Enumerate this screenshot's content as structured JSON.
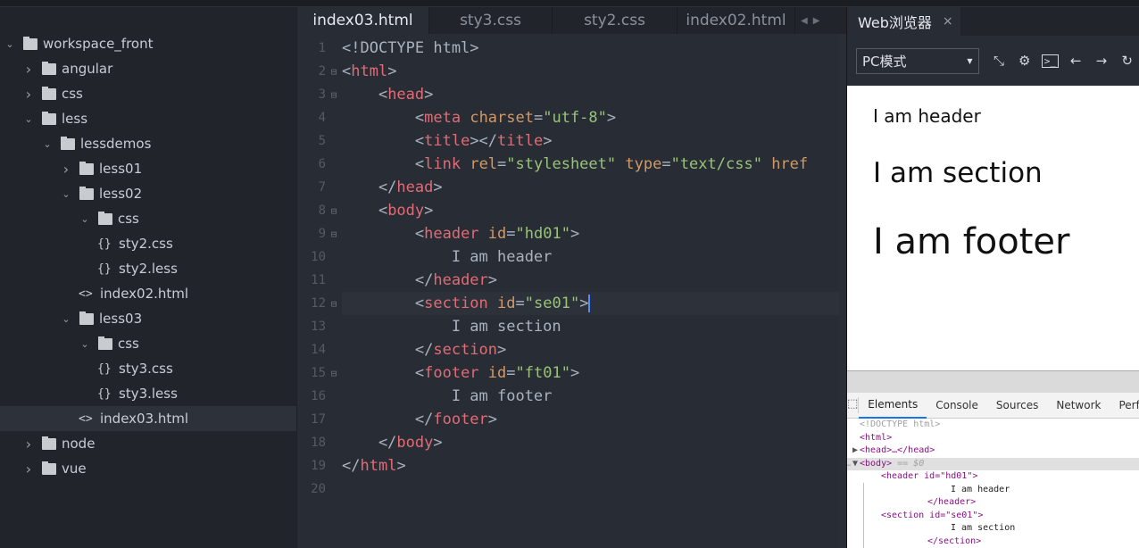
{
  "sidebar": {
    "items": [
      {
        "label": "workspace_front",
        "depth": 0,
        "kind": "project",
        "expanded": true
      },
      {
        "label": "angular",
        "depth": 1,
        "kind": "folder",
        "expanded": false
      },
      {
        "label": "css",
        "depth": 1,
        "kind": "folder",
        "expanded": false
      },
      {
        "label": "less",
        "depth": 1,
        "kind": "folder",
        "expanded": true
      },
      {
        "label": "lessdemos",
        "depth": 2,
        "kind": "folder",
        "expanded": true
      },
      {
        "label": "less01",
        "depth": 3,
        "kind": "folder",
        "expanded": false
      },
      {
        "label": "less02",
        "depth": 3,
        "kind": "folder",
        "expanded": true
      },
      {
        "label": "css",
        "depth": 4,
        "kind": "folder",
        "expanded": true
      },
      {
        "label": "sty2.css",
        "depth": 5,
        "kind": "css"
      },
      {
        "label": "sty2.less",
        "depth": 5,
        "kind": "css"
      },
      {
        "label": "index02.html",
        "depth": 4,
        "kind": "html"
      },
      {
        "label": "less03",
        "depth": 3,
        "kind": "folder",
        "expanded": true
      },
      {
        "label": "css",
        "depth": 4,
        "kind": "folder",
        "expanded": true
      },
      {
        "label": "sty3.css",
        "depth": 5,
        "kind": "css"
      },
      {
        "label": "sty3.less",
        "depth": 5,
        "kind": "css"
      },
      {
        "label": "index03.html",
        "depth": 4,
        "kind": "html",
        "selected": true
      },
      {
        "label": "node",
        "depth": 1,
        "kind": "folder",
        "expanded": false
      },
      {
        "label": "vue",
        "depth": 1,
        "kind": "folder",
        "expanded": false
      }
    ]
  },
  "editor": {
    "tabs": [
      {
        "label": "index03.html",
        "active": true
      },
      {
        "label": "sty3.css"
      },
      {
        "label": "sty2.css"
      },
      {
        "label": "index02.html"
      }
    ],
    "current_line": 12,
    "lines": [
      [
        [
          "p",
          "<!DOCTYPE html>"
        ]
      ],
      [
        [
          "p",
          "<"
        ],
        [
          "t",
          "html"
        ],
        [
          "p",
          ">"
        ]
      ],
      [
        [
          "p",
          "    <"
        ],
        [
          "t",
          "head"
        ],
        [
          "p",
          ">"
        ]
      ],
      [
        [
          "p",
          "        <"
        ],
        [
          "t",
          "meta"
        ],
        [
          "p",
          " "
        ],
        [
          "a",
          "charset"
        ],
        [
          "p",
          "="
        ],
        [
          "s",
          "\"utf-8\""
        ],
        [
          "p",
          ">"
        ]
      ],
      [
        [
          "p",
          "        <"
        ],
        [
          "t",
          "title"
        ],
        [
          "p",
          "></"
        ],
        [
          "t",
          "title"
        ],
        [
          "p",
          ">"
        ]
      ],
      [
        [
          "p",
          "        <"
        ],
        [
          "t",
          "link"
        ],
        [
          "p",
          " "
        ],
        [
          "a",
          "rel"
        ],
        [
          "p",
          "="
        ],
        [
          "s",
          "\"stylesheet\""
        ],
        [
          "p",
          " "
        ],
        [
          "a",
          "type"
        ],
        [
          "p",
          "="
        ],
        [
          "s",
          "\"text/css\""
        ],
        [
          "p",
          " "
        ],
        [
          "a",
          "href"
        ]
      ],
      [
        [
          "p",
          "    </"
        ],
        [
          "t",
          "head"
        ],
        [
          "p",
          ">"
        ]
      ],
      [
        [
          "p",
          "    <"
        ],
        [
          "t",
          "body"
        ],
        [
          "p",
          ">"
        ]
      ],
      [
        [
          "p",
          "        <"
        ],
        [
          "t",
          "header"
        ],
        [
          "p",
          " "
        ],
        [
          "a",
          "id"
        ],
        [
          "p",
          "="
        ],
        [
          "s",
          "\"hd01\""
        ],
        [
          "p",
          ">"
        ]
      ],
      [
        [
          "p",
          "            I am header"
        ]
      ],
      [
        [
          "p",
          "        </"
        ],
        [
          "t",
          "header"
        ],
        [
          "p",
          ">"
        ]
      ],
      [
        [
          "p",
          "        <"
        ],
        [
          "t",
          "section"
        ],
        [
          "p",
          " "
        ],
        [
          "a",
          "id"
        ],
        [
          "p",
          "="
        ],
        [
          "s",
          "\"se01\""
        ],
        [
          "p",
          ">"
        ]
      ],
      [
        [
          "p",
          "            I am section"
        ]
      ],
      [
        [
          "p",
          "        </"
        ],
        [
          "t",
          "section"
        ],
        [
          "p",
          ">"
        ]
      ],
      [
        [
          "p",
          "        <"
        ],
        [
          "t",
          "footer"
        ],
        [
          "p",
          " "
        ],
        [
          "a",
          "id"
        ],
        [
          "p",
          "="
        ],
        [
          "s",
          "\"ft01\""
        ],
        [
          "p",
          ">"
        ]
      ],
      [
        [
          "p",
          "            I am footer"
        ]
      ],
      [
        [
          "p",
          "        </"
        ],
        [
          "t",
          "footer"
        ],
        [
          "p",
          ">"
        ]
      ],
      [
        [
          "p",
          "    </"
        ],
        [
          "t",
          "body"
        ],
        [
          "p",
          ">"
        ]
      ],
      [
        [
          "p",
          "</"
        ],
        [
          "t",
          "html"
        ],
        [
          "p",
          ">"
        ]
      ],
      []
    ],
    "foldable": [
      2,
      3,
      8,
      9,
      12,
      15
    ]
  },
  "browser": {
    "tab_label": "Web浏览器",
    "close": "×",
    "mode": "PC模式",
    "toolbar_icons": [
      "resize-icon",
      "gear-icon",
      "console-icon",
      "back-arrow-icon",
      "forward-arrow-icon",
      "refresh-icon"
    ],
    "page": {
      "header": "I am header",
      "section": "I am section",
      "footer": "I am footer"
    },
    "devtools": {
      "tabs": [
        "Elements",
        "Console",
        "Sources",
        "Network",
        "Perf"
      ],
      "active_tab": "Elements",
      "dom": [
        {
          "text": "<!DOCTYPE html>"
        },
        {
          "text": "<html>"
        },
        {
          "text": "<head>…</head>"
        },
        {
          "text": "<body>",
          "suffix": " == $0"
        },
        {
          "text": "<header id=\"hd01\">"
        },
        {
          "text": "I am header"
        },
        {
          "text": "</header>"
        },
        {
          "text": "<section id=\"se01\">"
        },
        {
          "text": "I am section"
        },
        {
          "text": "</section>"
        }
      ]
    }
  }
}
